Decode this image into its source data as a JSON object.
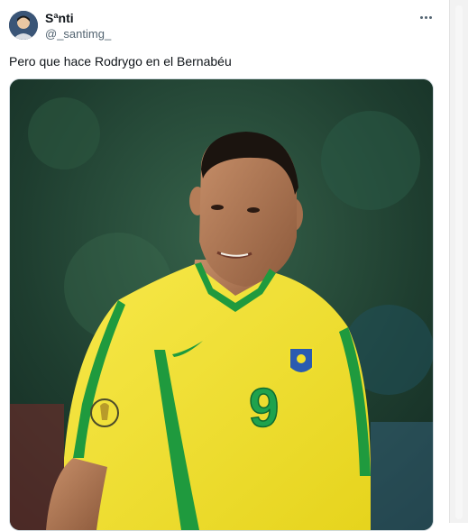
{
  "author": {
    "display_name": "Sªnti",
    "handle": "@_santimg_"
  },
  "tweet": {
    "text": "Pero que hace Rodrygo en el Bernabéu"
  },
  "media": {
    "jersey_number": "9",
    "jersey_color": "#f3e12a",
    "trim_color": "#1f9a3e"
  },
  "icons": {
    "more": "more-horizontal-icon"
  }
}
